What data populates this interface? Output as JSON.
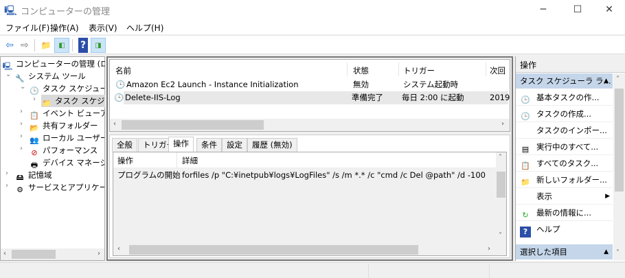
{
  "window": {
    "title": "コンピューターの管理",
    "minimize": "─",
    "maximize": "☐",
    "close": "✕"
  },
  "menu": [
    "ファイル(F)",
    "操作(A)",
    "表示(V)",
    "ヘルプ(H)"
  ],
  "toolbar": {
    "back": "⇦",
    "forward": "⇨",
    "up": "📁",
    "help": "?"
  },
  "tree": [
    {
      "label": "コンピューターの管理 (ローカル)",
      "icon": "computer-icon"
    },
    {
      "label": "システム ツール",
      "icon": "tools-icon"
    },
    {
      "label": "タスク スケジューラ",
      "icon": "clock-icon"
    },
    {
      "label": "タスク スケジューラ ライブラリ",
      "icon": "folder-clock-icon"
    },
    {
      "label": "イベント ビューアー",
      "icon": "event-viewer-icon"
    },
    {
      "label": "共有フォルダー",
      "icon": "shared-folder-icon"
    },
    {
      "label": "ローカル ユーザーとグループ",
      "icon": "users-icon"
    },
    {
      "label": "パフォーマンス",
      "icon": "performance-icon"
    },
    {
      "label": "デバイス マネージャー",
      "icon": "device-manager-icon"
    },
    {
      "label": "記憶域",
      "icon": "storage-icon"
    },
    {
      "label": "サービスとアプリケーション",
      "icon": "services-icon"
    }
  ],
  "tasks": {
    "columns": [
      "名前",
      "状態",
      "トリガー",
      "次回"
    ],
    "rows": [
      {
        "name": "Amazon Ec2 Launch - Instance Initialization",
        "status": "無効",
        "trigger": "システム起動時",
        "next": ""
      },
      {
        "name": "Delete-IIS-Log",
        "status": "準備完了",
        "trigger": "毎日 2:00 に起動",
        "next": "2019"
      }
    ]
  },
  "tabs": [
    "全般",
    "トリガー",
    "操作",
    "条件",
    "設定",
    "履歴 (無効)"
  ],
  "actions_table": {
    "columns": [
      "操作",
      "詳細"
    ],
    "rows": [
      {
        "action": "プログラムの開始",
        "detail": "forfiles /p \"C:¥inetpub¥logs¥LogFiles\" /s /m *.* /c \"cmd /c Del @path\" /d -100"
      }
    ]
  },
  "actions_pane": {
    "title": "操作",
    "section1": "タスク スケジューラ ラ...",
    "items": [
      {
        "label": "基本タスクの作...",
        "icon": "basic-task-icon"
      },
      {
        "label": "タスクの作成...",
        "icon": "create-task-icon"
      },
      {
        "label": "タスクのインポー...",
        "icon": ""
      },
      {
        "label": "実行中のすべて...",
        "icon": "running-tasks-icon"
      },
      {
        "label": "すべてのタスク...",
        "icon": "all-tasks-icon"
      },
      {
        "label": "新しいフォルダー...",
        "icon": "new-folder-icon"
      },
      {
        "label": "表示",
        "icon": ""
      },
      {
        "label": "最新の情報に...",
        "icon": "refresh-icon"
      },
      {
        "label": "ヘルプ",
        "icon": "help-icon"
      }
    ],
    "section2": "選択した項目"
  }
}
